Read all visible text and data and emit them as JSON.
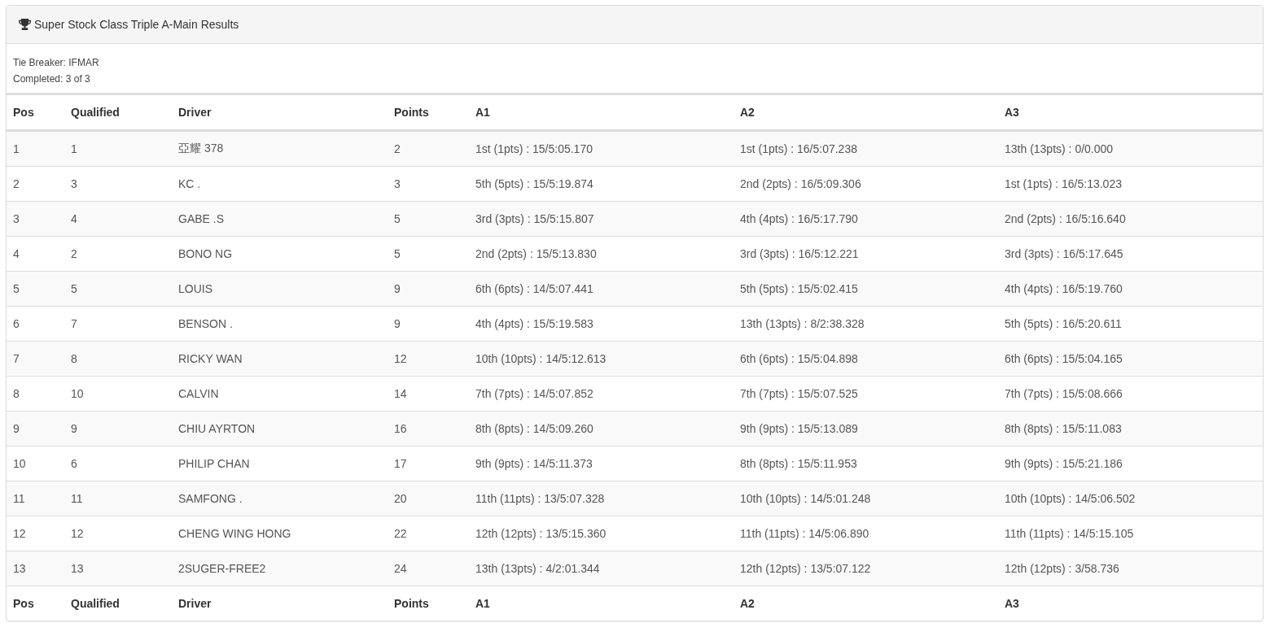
{
  "panel": {
    "title": "Super Stock Class Triple A-Main Results",
    "info": [
      "Tie Breaker: IFMAR",
      "Completed: 3 of 3"
    ]
  },
  "table": {
    "columns": [
      "Pos",
      "Qualified",
      "Driver",
      "Points",
      "A1",
      "A2",
      "A3"
    ],
    "rows": [
      [
        "1",
        "1",
        "亞耀 378",
        "2",
        "1st (1pts) : 15/5:05.170",
        "1st (1pts) : 16/5:07.238",
        "13th (13pts) : 0/0.000"
      ],
      [
        "2",
        "3",
        "KC .",
        "3",
        "5th (5pts) : 15/5:19.874",
        "2nd (2pts) : 16/5:09.306",
        "1st (1pts) : 16/5:13.023"
      ],
      [
        "3",
        "4",
        "GABE .S",
        "5",
        "3rd (3pts) : 15/5:15.807",
        "4th (4pts) : 16/5:17.790",
        "2nd (2pts) : 16/5:16.640"
      ],
      [
        "4",
        "2",
        "BONO NG",
        "5",
        "2nd (2pts) : 15/5:13.830",
        "3rd (3pts) : 16/5:12.221",
        "3rd (3pts) : 16/5:17.645"
      ],
      [
        "5",
        "5",
        "LOUIS",
        "9",
        "6th (6pts) : 14/5:07.441",
        "5th (5pts) : 15/5:02.415",
        "4th (4pts) : 16/5:19.760"
      ],
      [
        "6",
        "7",
        "BENSON .",
        "9",
        "4th (4pts) : 15/5:19.583",
        "13th (13pts) : 8/2:38.328",
        "5th (5pts) : 16/5:20.611"
      ],
      [
        "7",
        "8",
        "RICKY WAN",
        "12",
        "10th (10pts) : 14/5:12.613",
        "6th (6pts) : 15/5:04.898",
        "6th (6pts) : 15/5:04.165"
      ],
      [
        "8",
        "10",
        "CALVIN",
        "14",
        "7th (7pts) : 14/5:07.852",
        "7th (7pts) : 15/5:07.525",
        "7th (7pts) : 15/5:08.666"
      ],
      [
        "9",
        "9",
        "CHIU AYRTON",
        "16",
        "8th (8pts) : 14/5:09.260",
        "9th (9pts) : 15/5:13.089",
        "8th (8pts) : 15/5:11.083"
      ],
      [
        "10",
        "6",
        "PHILIP CHAN",
        "17",
        "9th (9pts) : 14/5:11.373",
        "8th (8pts) : 15/5:11.953",
        "9th (9pts) : 15/5:21.186"
      ],
      [
        "11",
        "11",
        "SAMFONG .",
        "20",
        "11th (11pts) : 13/5:07.328",
        "10th (10pts) : 14/5:01.248",
        "10th (10pts) : 14/5:06.502"
      ],
      [
        "12",
        "12",
        "CHENG WING HONG",
        "22",
        "12th (12pts) : 13/5:15.360",
        "11th (11pts) : 14/5:06.890",
        "11th (11pts) : 14/5:15.105"
      ],
      [
        "13",
        "13",
        "2SUGER-FREE2",
        "24",
        "13th (13pts) : 4/2:01.344",
        "12th (12pts) : 13/5:07.122",
        "12th (12pts) : 3/58.736"
      ]
    ],
    "footer": [
      "Pos",
      "Qualified",
      "Driver",
      "Points",
      "A1",
      "A2",
      "A3"
    ]
  }
}
